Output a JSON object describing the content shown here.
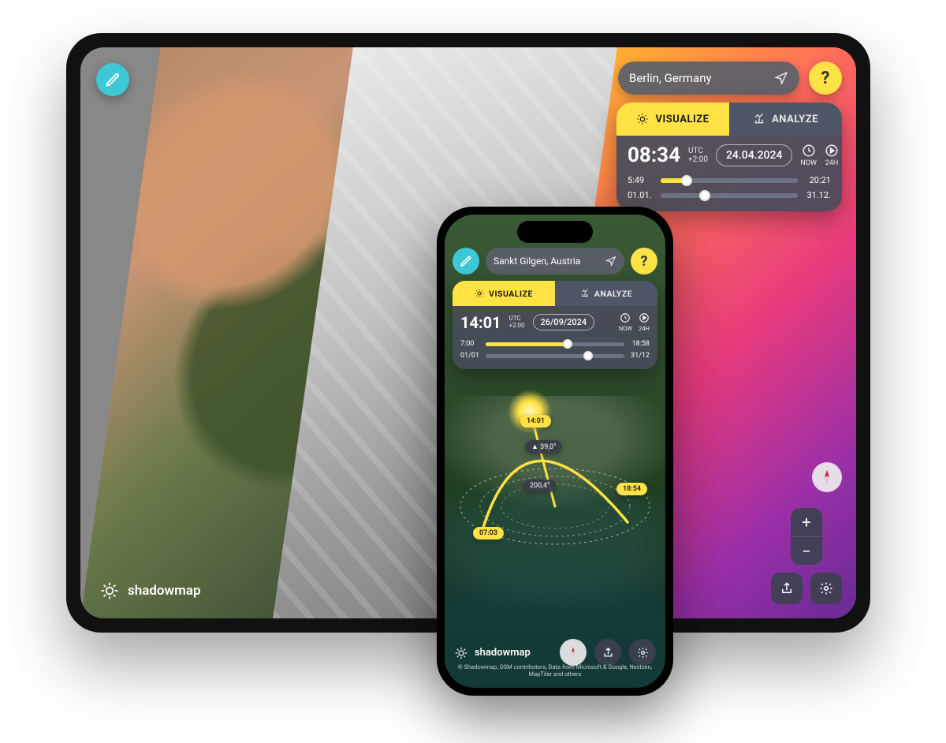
{
  "brand": "shadowmap",
  "tablet": {
    "search": "Berlin, Germany",
    "help": "?",
    "tabs": {
      "visualize": "VISUALIZE",
      "analyze": "ANALYZE"
    },
    "time": "08:34",
    "tz_line1": "UTC",
    "tz_line2": "+2:00",
    "date": "24.04.2024",
    "now": "NOW",
    "mode24": "24H",
    "time_slider": {
      "start": "5:49",
      "end": "20:21",
      "percent": 19
    },
    "date_slider": {
      "start": "01.01.",
      "end": "31.12.",
      "percent": 32
    }
  },
  "phone": {
    "search": "Sankt Gilgen, Austria",
    "help": "?",
    "tabs": {
      "visualize": "VISUALIZE",
      "analyze": "ANALYZE"
    },
    "time": "14:01",
    "tz_line1": "UTC",
    "tz_line2": "+2:00",
    "date": "26/09/2024",
    "now": "NOW",
    "mode24": "24H",
    "time_slider": {
      "start": "7:00",
      "end": "18:58",
      "percent": 59
    },
    "date_slider": {
      "start": "01/01",
      "end": "31/12",
      "percent": 74
    },
    "sun": {
      "current_label": "14:01",
      "altitude": "▲ 39,0°",
      "azimuth": "200,4°",
      "sunrise": "07:03",
      "sunset": "18:54"
    },
    "credits": "© Shadowmap, OSM contributors, Data from Microsoft & Google, Nextzen, MapTiler and others"
  }
}
